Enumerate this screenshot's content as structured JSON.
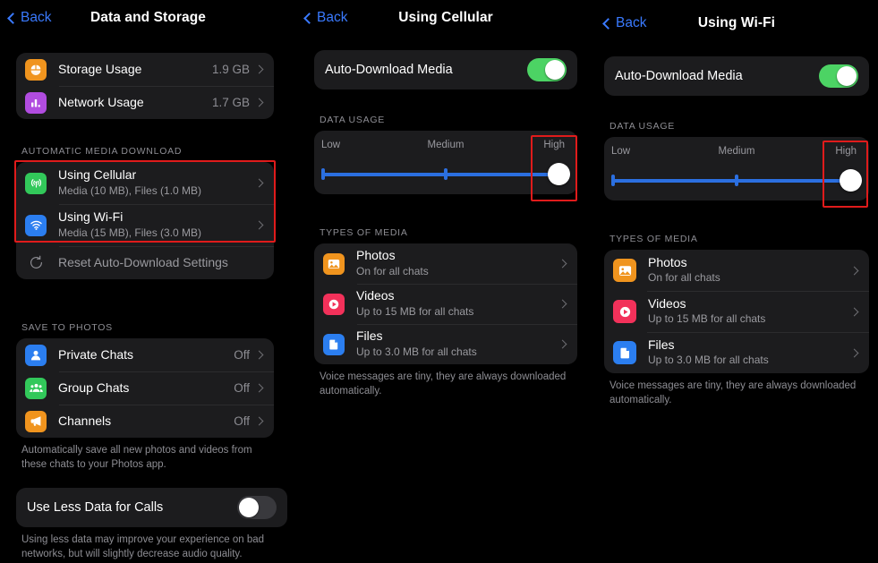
{
  "theme": {
    "background": "#000000",
    "card": "#1c1c1e",
    "accent_blue": "#3a7afe",
    "toggle_on": "#4cd364",
    "slider_blue": "#2b6fe0",
    "highlight_red": "#e01b1b",
    "label_gray": "#8d8d93"
  },
  "panels": {
    "left": {
      "nav": {
        "back_label": "Back",
        "title": "Data and Storage"
      },
      "usage_rows": [
        {
          "icon": "storage-usage-icon",
          "title": "Storage Usage",
          "value": "1.9 GB",
          "icon_color": "#f0941e"
        },
        {
          "icon": "network-usage-icon",
          "title": "Network Usage",
          "value": "1.7 GB",
          "icon_color": "#b14ce0"
        }
      ],
      "auto_download": {
        "section_label": "AUTOMATIC MEDIA DOWNLOAD",
        "rows": [
          {
            "icon": "cellular-icon",
            "title": "Using Cellular",
            "subtitle": "Media (10 MB), Files (1.0 MB)",
            "icon_color": "#32c85a"
          },
          {
            "icon": "wifi-icon",
            "title": "Using Wi-Fi",
            "subtitle": "Media (15 MB), Files (3.0 MB)",
            "icon_color": "#2b7ef0"
          }
        ],
        "reset_label": "Reset Auto-Download Settings",
        "reset_icon": "reset-arrow-icon"
      },
      "save_to_photos": {
        "section_label": "SAVE TO PHOTOS",
        "rows": [
          {
            "icon": "person-icon",
            "title": "Private Chats",
            "value": "Off",
            "icon_color": "#2b7ef0"
          },
          {
            "icon": "group-icon",
            "title": "Group Chats",
            "value": "Off",
            "icon_color": "#32c85a"
          },
          {
            "icon": "megaphone-icon",
            "title": "Channels",
            "value": "Off",
            "icon_color": "#f0941e"
          }
        ],
        "footnote": "Automatically save all new photos and videos from these chats to your Photos app."
      },
      "less_data": {
        "title": "Use Less Data for Calls",
        "toggle_state": "off",
        "footnote": "Using less data may improve your experience on bad networks, but will slightly decrease audio quality."
      }
    },
    "middle": {
      "nav": {
        "back_label": "Back",
        "title": "Using Cellular"
      },
      "auto_download_media": {
        "title": "Auto-Download Media",
        "toggle_state": "on"
      },
      "data_usage": {
        "section_label": "DATA USAGE",
        "labels": {
          "low": "Low",
          "medium": "Medium",
          "high": "High"
        },
        "selected": "High",
        "steps": 3,
        "value_index": 2
      },
      "types_of_media": {
        "section_label": "TYPES OF MEDIA",
        "rows": [
          {
            "icon": "photos-icon",
            "title": "Photos",
            "subtitle": "On for all chats",
            "icon_color": "#f0941e"
          },
          {
            "icon": "videos-icon",
            "title": "Videos",
            "subtitle": "Up to 15 MB for all chats",
            "icon_color": "#f2315a"
          },
          {
            "icon": "files-icon",
            "title": "Files",
            "subtitle": "Up to 3.0 MB for all chats",
            "icon_color": "#2b7ef0"
          }
        ],
        "footnote": "Voice messages are tiny, they are always downloaded automatically."
      }
    },
    "right": {
      "nav": {
        "back_label": "Back",
        "title": "Using Wi-Fi"
      },
      "auto_download_media": {
        "title": "Auto-Download Media",
        "toggle_state": "on"
      },
      "data_usage": {
        "section_label": "DATA USAGE",
        "labels": {
          "low": "Low",
          "medium": "Medium",
          "high": "High"
        },
        "selected": "High",
        "steps": 3,
        "value_index": 2
      },
      "types_of_media": {
        "section_label": "TYPES OF MEDIA",
        "rows": [
          {
            "icon": "photos-icon",
            "title": "Photos",
            "subtitle": "On for all chats",
            "icon_color": "#f0941e"
          },
          {
            "icon": "videos-icon",
            "title": "Videos",
            "subtitle": "Up to 15 MB for all chats",
            "icon_color": "#f2315a"
          },
          {
            "icon": "files-icon",
            "title": "Files",
            "subtitle": "Up to 3.0 MB for all chats",
            "icon_color": "#2b7ef0"
          }
        ],
        "footnote": "Voice messages are tiny, they are always downloaded automatically."
      }
    }
  },
  "annotations": [
    {
      "name": "highlight-auto-download-rows",
      "panel": "left"
    },
    {
      "name": "highlight-high-slider-cellular",
      "panel": "middle"
    },
    {
      "name": "highlight-high-slider-wifi",
      "panel": "right"
    }
  ]
}
